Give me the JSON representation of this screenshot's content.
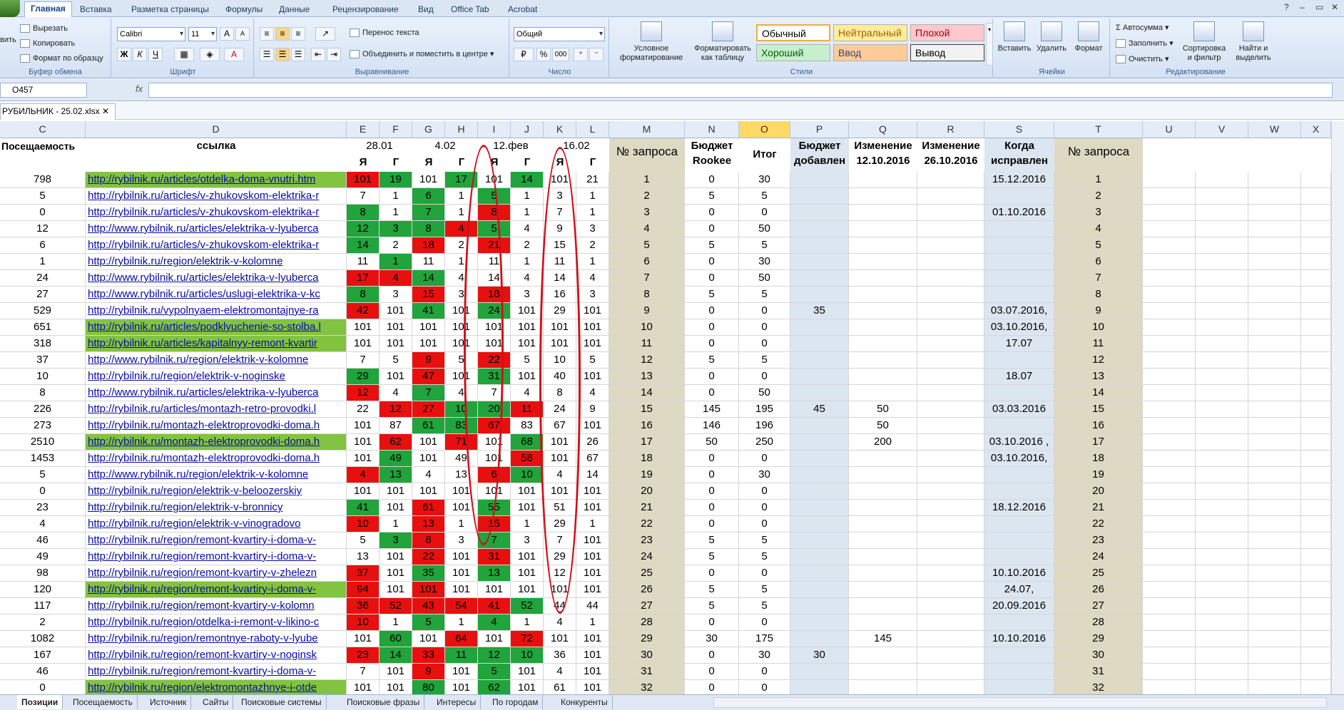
{
  "window": {
    "min": "–",
    "max": "▭",
    "close": "✕",
    "help": "?"
  },
  "ribbon_tabs": [
    "Главная",
    "Вставка",
    "Разметка страницы",
    "Формулы",
    "Данные",
    "Рецензирование",
    "Вид",
    "Office Tab",
    "Acrobat"
  ],
  "clipboard": {
    "cut": "Вырезать",
    "copy": "Копировать",
    "format": "Формат по образцу",
    "paste": "вить",
    "label": "Буфер обмена"
  },
  "font": {
    "name": "Calibri",
    "size": "11",
    "bold": "Ж",
    "italic": "К",
    "underline": "Ч",
    "grow": "A",
    "shrink": "A",
    "label": "Шрифт"
  },
  "align": {
    "wrap": "Перенос текста",
    "merge": "Объединить и поместить в центре",
    "label": "Выравнивание"
  },
  "number": {
    "format": "Общий",
    "pct": "%",
    "thousands": "000",
    "label": "Число"
  },
  "styles": {
    "cond": "Условное форматирование",
    "table": "Форматировать как таблицу",
    "normal": "Обычный",
    "neutral": "Нейтральный",
    "bad": "Плохой",
    "good": "Хороший",
    "input": "Ввод",
    "output": "Вывод",
    "label": "Стили"
  },
  "cells": {
    "insert": "Вставить",
    "delete": "Удалить",
    "format": "Формат",
    "label": "Ячейки"
  },
  "editing": {
    "autosum": "Автосумма",
    "fill": "Заполнить",
    "clear": "Очистить",
    "sort": "Сортировка и фильтр",
    "find": "Найти и выделить",
    "label": "Редактирование"
  },
  "namebox": "O457",
  "fx": "fx",
  "doc_tab": "РУБИЛЬНИК - 25.02.xlsx",
  "columns": [
    "C",
    "D",
    "E",
    "F",
    "G",
    "H",
    "I",
    "J",
    "K",
    "L",
    "M",
    "N",
    "O",
    "P",
    "Q",
    "R",
    "S",
    "T",
    "U",
    "V",
    "W",
    "X"
  ],
  "headers": {
    "c": "Посещаемость",
    "d": "ссылка",
    "d1": "28.01",
    "d2": "4.02",
    "d3": "12.фев",
    "d4": "16.02",
    "ya": "Я",
    "g": "Г",
    "m": "№ запроса",
    "n": "Бюджет Rookee",
    "o": "Итог",
    "p": "Бюджет добавлен",
    "q": "Изменение 12.10.2016",
    "r": "Изменение 26.10.2016",
    "s": "Когда исправлен",
    "t": "№ запроса"
  },
  "rows": [
    {
      "c": "798",
      "d": "http://rybilnik.ru/articles/otdelka-doma-vnutri.htm",
      "dg": 1,
      "v": [
        "101",
        "19",
        "101",
        "17",
        "101",
        "14",
        "101",
        "21"
      ],
      "cl": [
        "r",
        "g",
        "",
        "g",
        "",
        "g",
        "",
        ""
      ],
      "m": "1",
      "n": "0",
      "o": "30",
      "p": "",
      "q": "",
      "s": "15.12.2016",
      "t": "1"
    },
    {
      "c": "5",
      "d": "http://rybilnik.ru/articles/v-zhukovskom-elektrika-r",
      "v": [
        "7",
        "1",
        "6",
        "1",
        "5",
        "1",
        "3",
        "1"
      ],
      "cl": [
        "",
        "",
        "g",
        "",
        "g",
        "",
        "",
        ""
      ],
      "m": "2",
      "n": "5",
      "o": "5",
      "p": "",
      "q": "",
      "s": "",
      "t": "2"
    },
    {
      "c": "0",
      "d": "http://rybilnik.ru/articles/v-zhukovskom-elektrika-r",
      "v": [
        "8",
        "1",
        "7",
        "1",
        "8",
        "1",
        "7",
        "1"
      ],
      "cl": [
        "g",
        "",
        "g",
        "",
        "r",
        "",
        "",
        ""
      ],
      "m": "3",
      "n": "0",
      "o": "0",
      "p": "",
      "q": "",
      "s": "01.10.2016",
      "t": "3"
    },
    {
      "c": "12",
      "d": "http://www.rybilnik.ru/articles/elektrika-v-lyubercа",
      "v": [
        "12",
        "3",
        "8",
        "4",
        "5",
        "4",
        "9",
        "3"
      ],
      "cl": [
        "g",
        "g",
        "g",
        "r",
        "g",
        "",
        "",
        ""
      ],
      "m": "4",
      "n": "0",
      "o": "50",
      "p": "",
      "q": "",
      "s": "",
      "t": "4"
    },
    {
      "c": "6",
      "d": "http://rybilnik.ru/articles/v-zhukovskom-elektrika-r",
      "v": [
        "14",
        "2",
        "18",
        "2",
        "21",
        "2",
        "15",
        "2"
      ],
      "cl": [
        "g",
        "",
        "r",
        "",
        "r",
        "",
        "",
        ""
      ],
      "m": "5",
      "n": "5",
      "o": "5",
      "p": "",
      "q": "",
      "s": "",
      "t": "5"
    },
    {
      "c": "1",
      "d": "http://rybilnik.ru/region/elektrik-v-kolomne",
      "v": [
        "11",
        "1",
        "11",
        "1",
        "11",
        "1",
        "11",
        "1"
      ],
      "cl": [
        "",
        "g",
        "",
        "",
        "",
        "",
        "",
        ""
      ],
      "m": "6",
      "n": "0",
      "o": "30",
      "p": "",
      "q": "",
      "s": "",
      "t": "6"
    },
    {
      "c": "24",
      "d": "http://www.rybilnik.ru/articles/elektrika-v-lyubercа",
      "v": [
        "17",
        "4",
        "14",
        "4",
        "14",
        "4",
        "14",
        "4"
      ],
      "cl": [
        "r",
        "r",
        "g",
        "",
        "",
        "",
        "",
        ""
      ],
      "m": "7",
      "n": "0",
      "o": "50",
      "p": "",
      "q": "",
      "s": "",
      "t": "7"
    },
    {
      "c": "27",
      "d": "http://www.rybilnik.ru/articles/uslugi-elektrika-v-kc",
      "v": [
        "8",
        "3",
        "15",
        "3",
        "18",
        "3",
        "16",
        "3"
      ],
      "cl": [
        "g",
        "",
        "r",
        "",
        "r",
        "",
        "",
        ""
      ],
      "m": "8",
      "n": "5",
      "o": "5",
      "p": "",
      "q": "",
      "s": "",
      "t": "8"
    },
    {
      "c": "529",
      "d": "http://rybilnik.ru/vypolnyaem-elektromontajnye-ra",
      "v": [
        "42",
        "101",
        "41",
        "101",
        "24",
        "101",
        "29",
        "101"
      ],
      "cl": [
        "r",
        "",
        "g",
        "",
        "g",
        "",
        "",
        ""
      ],
      "m": "9",
      "n": "0",
      "o": "0",
      "p": "35",
      "q": "",
      "s": "03.07.2016,",
      "t": "9"
    },
    {
      "c": "651",
      "d": "http://rybilnik.ru/articles/podklyuchenie-so-stolba.l",
      "dg": 1,
      "v": [
        "101",
        "101",
        "101",
        "101",
        "101",
        "101",
        "101",
        "101"
      ],
      "cl": [
        "",
        "",
        "",
        "",
        "",
        "",
        "",
        ""
      ],
      "m": "10",
      "n": "0",
      "o": "0",
      "p": "",
      "q": "",
      "s": "03.10.2016,",
      "t": "10"
    },
    {
      "c": "318",
      "d": "http://rybilnik.ru/articles/kapitalnyy-remont-kvartir",
      "dg": 1,
      "v": [
        "101",
        "101",
        "101",
        "101",
        "101",
        "101",
        "101",
        "101"
      ],
      "cl": [
        "",
        "",
        "",
        "",
        "",
        "",
        "",
        ""
      ],
      "m": "11",
      "n": "0",
      "o": "0",
      "p": "",
      "q": "",
      "s": "17.07",
      "t": "11"
    },
    {
      "c": "37",
      "d": "http://www.rybilnik.ru/region/elektrik-v-kolomne",
      "v": [
        "7",
        "5",
        "9",
        "5",
        "22",
        "5",
        "10",
        "5"
      ],
      "cl": [
        "",
        "",
        "r",
        "",
        "r",
        "",
        "",
        ""
      ],
      "m": "12",
      "n": "5",
      "o": "5",
      "p": "",
      "q": "",
      "s": "",
      "t": "12"
    },
    {
      "c": "10",
      "d": "http://rybilnik.ru/region/elektrik-v-noginske",
      "v": [
        "29",
        "101",
        "47",
        "101",
        "31",
        "101",
        "40",
        "101"
      ],
      "cl": [
        "g",
        "",
        "r",
        "",
        "g",
        "",
        "",
        ""
      ],
      "m": "13",
      "n": "0",
      "o": "0",
      "p": "",
      "q": "",
      "s": "18.07",
      "t": "13"
    },
    {
      "c": "8",
      "d": "http://www.rybilnik.ru/articles/elektrika-v-lyubercа",
      "v": [
        "12",
        "4",
        "7",
        "4",
        "7",
        "4",
        "8",
        "4"
      ],
      "cl": [
        "r",
        "",
        "g",
        "",
        "",
        "",
        "",
        ""
      ],
      "m": "14",
      "n": "0",
      "o": "50",
      "p": "",
      "q": "",
      "s": "",
      "t": "14"
    },
    {
      "c": "226",
      "d": "http://rybilnik.ru/articles/montazh-retro-provodki.l",
      "v": [
        "22",
        "12",
        "27",
        "10",
        "20",
        "11",
        "24",
        "9"
      ],
      "cl": [
        "",
        "r",
        "r",
        "g",
        "g",
        "r",
        "",
        ""
      ],
      "m": "15",
      "n": "145",
      "o": "195",
      "p": "45",
      "q": "50",
      "s": "03.03.2016",
      "t": "15"
    },
    {
      "c": "273",
      "d": "http://rybilnik.ru/montazh-elektroprovodki-doma.h",
      "v": [
        "101",
        "87",
        "61",
        "83",
        "67",
        "83",
        "67",
        "101"
      ],
      "cl": [
        "",
        "",
        "g",
        "g",
        "r",
        "",
        "",
        ""
      ],
      "m": "16",
      "n": "146",
      "o": "196",
      "p": "",
      "q": "50",
      "s": "",
      "t": "16"
    },
    {
      "c": "2510",
      "d": "http://rybilnik.ru/montazh-elektroprovodki-doma.h",
      "dg": 1,
      "v": [
        "101",
        "62",
        "101",
        "71",
        "101",
        "68",
        "101",
        "26"
      ],
      "cl": [
        "",
        "r",
        "",
        "r",
        "",
        "g",
        "",
        ""
      ],
      "m": "17",
      "n": "50",
      "o": "250",
      "p": "",
      "q": "200",
      "s": "03.10.2016 ,",
      "t": "17"
    },
    {
      "c": "1453",
      "d": "http://rybilnik.ru/montazh-elektroprovodki-doma.h",
      "v": [
        "101",
        "49",
        "101",
        "49",
        "101",
        "58",
        "101",
        "67"
      ],
      "cl": [
        "",
        "g",
        "",
        "",
        "",
        "r",
        "",
        ""
      ],
      "m": "18",
      "n": "0",
      "o": "0",
      "p": "",
      "q": "",
      "s": "03.10.2016,",
      "t": "18"
    },
    {
      "c": "5",
      "d": "http://www.rybilnik.ru/region/elektrik-v-kolomne",
      "v": [
        "4",
        "13",
        "4",
        "13",
        "6",
        "10",
        "4",
        "14"
      ],
      "cl": [
        "r",
        "g",
        "",
        "",
        "r",
        "g",
        "",
        ""
      ],
      "m": "19",
      "n": "0",
      "o": "30",
      "p": "",
      "q": "",
      "s": "",
      "t": "19"
    },
    {
      "c": "0",
      "d": "http://rybilnik.ru/region/elektrik-v-beloozerskiy",
      "v": [
        "101",
        "101",
        "101",
        "101",
        "101",
        "101",
        "101",
        "101"
      ],
      "cl": [
        "",
        "",
        "",
        "",
        "",
        "",
        "",
        ""
      ],
      "m": "20",
      "n": "0",
      "o": "0",
      "p": "",
      "q": "",
      "s": "",
      "t": "20"
    },
    {
      "c": "23",
      "d": "http://rybilnik.ru/region/elektrik-v-bronnicy",
      "v": [
        "41",
        "101",
        "61",
        "101",
        "55",
        "101",
        "51",
        "101"
      ],
      "cl": [
        "g",
        "",
        "r",
        "",
        "g",
        "",
        "",
        ""
      ],
      "m": "21",
      "n": "0",
      "o": "0",
      "p": "",
      "q": "",
      "s": "18.12.2016",
      "t": "21"
    },
    {
      "c": "4",
      "d": "http://rybilnik.ru/region/elektrik-v-vinogradovo",
      "v": [
        "10",
        "1",
        "13",
        "1",
        "15",
        "1",
        "29",
        "1"
      ],
      "cl": [
        "r",
        "",
        "r",
        "",
        "r",
        "",
        "",
        ""
      ],
      "m": "22",
      "n": "0",
      "o": "0",
      "p": "",
      "q": "",
      "s": "",
      "t": "22"
    },
    {
      "c": "46",
      "d": "http://rybilnik.ru/region/remont-kvartiry-i-doma-v-",
      "v": [
        "5",
        "3",
        "8",
        "3",
        "7",
        "3",
        "7",
        "101"
      ],
      "cl": [
        "",
        "g",
        "r",
        "",
        "g",
        "",
        "",
        ""
      ],
      "m": "23",
      "n": "5",
      "o": "5",
      "p": "",
      "q": "",
      "s": "",
      "t": "23"
    },
    {
      "c": "49",
      "d": "http://rybilnik.ru/region/remont-kvartiry-i-doma-v-",
      "v": [
        "13",
        "101",
        "22",
        "101",
        "31",
        "101",
        "29",
        "101"
      ],
      "cl": [
        "",
        "",
        "r",
        "",
        "r",
        "",
        "",
        ""
      ],
      "m": "24",
      "n": "5",
      "o": "5",
      "p": "",
      "q": "",
      "s": "",
      "t": "24"
    },
    {
      "c": "98",
      "d": "http://rybilnik.ru/region/remont-kvartiry-v-zhelezn",
      "v": [
        "37",
        "101",
        "35",
        "101",
        "13",
        "101",
        "12",
        "101"
      ],
      "cl": [
        "r",
        "",
        "g",
        "",
        "g",
        "",
        "",
        ""
      ],
      "m": "25",
      "n": "0",
      "o": "0",
      "p": "",
      "q": "",
      "s": "10.10.2016",
      "t": "25"
    },
    {
      "c": "120",
      "d": "http://rybilnik.ru/region/remont-kvartiry-i-doma-v-",
      "dg": 1,
      "v": [
        "94",
        "101",
        "101",
        "101",
        "101",
        "101",
        "101",
        "101"
      ],
      "cl": [
        "r",
        "",
        "r",
        "",
        "",
        "",
        "",
        ""
      ],
      "m": "26",
      "n": "5",
      "o": "5",
      "p": "",
      "q": "",
      "s": "24.07,",
      "t": "26"
    },
    {
      "c": "117",
      "d": "http://rybilnik.ru/region/remont-kvartiry-v-kolomn",
      "v": [
        "36",
        "52",
        "43",
        "54",
        "41",
        "52",
        "44",
        "44"
      ],
      "cl": [
        "r",
        "r",
        "r",
        "r",
        "r",
        "g",
        "",
        ""
      ],
      "m": "27",
      "n": "5",
      "o": "5",
      "p": "",
      "q": "",
      "s": "20.09.2016",
      "t": "27"
    },
    {
      "c": "2",
      "d": "http://rybilnik.ru/region/otdelka-i-remont-v-likino-c",
      "v": [
        "10",
        "1",
        "5",
        "1",
        "4",
        "1",
        "4",
        "1"
      ],
      "cl": [
        "r",
        "",
        "g",
        "",
        "g",
        "",
        "",
        ""
      ],
      "m": "28",
      "n": "0",
      "o": "0",
      "p": "",
      "q": "",
      "s": "",
      "t": "28"
    },
    {
      "c": "1082",
      "d": "http://rybilnik.ru/region/remontnye-raboty-v-lyube",
      "v": [
        "101",
        "60",
        "101",
        "64",
        "101",
        "72",
        "101",
        "101"
      ],
      "cl": [
        "",
        "g",
        "",
        "r",
        "",
        "r",
        "",
        ""
      ],
      "m": "29",
      "n": "30",
      "o": "175",
      "p": "",
      "q": "145",
      "s": "10.10.2016",
      "t": "29"
    },
    {
      "c": "167",
      "d": "http://rybilnik.ru/region/remont-kvartiry-v-noginsk",
      "v": [
        "23",
        "14",
        "33",
        "11",
        "12",
        "10",
        "36",
        "101"
      ],
      "cl": [
        "r",
        "g",
        "r",
        "g",
        "g",
        "g",
        "",
        ""
      ],
      "m": "30",
      "n": "0",
      "o": "30",
      "p": "30",
      "q": "",
      "s": "",
      "t": "30"
    },
    {
      "c": "46",
      "d": "http://rybilnik.ru/region/remont-kvartiry-i-doma-v-",
      "v": [
        "7",
        "101",
        "9",
        "101",
        "5",
        "101",
        "4",
        "101"
      ],
      "cl": [
        "",
        "",
        "r",
        "",
        "g",
        "",
        "",
        ""
      ],
      "m": "31",
      "n": "0",
      "o": "0",
      "p": "",
      "q": "",
      "s": "",
      "t": "31"
    },
    {
      "c": "0",
      "d": "http://rybilnik.ru/region/elektromontazhnye-i-otde",
      "dg": 1,
      "v": [
        "101",
        "101",
        "80",
        "101",
        "62",
        "101",
        "61",
        "101"
      ],
      "cl": [
        "",
        "",
        "g",
        "",
        "g",
        "",
        "",
        ""
      ],
      "m": "32",
      "n": "0",
      "o": "0",
      "p": "",
      "q": "",
      "s": "",
      "t": "32"
    }
  ],
  "sheet_tabs": [
    "Позиции",
    "Посещаемость",
    "Источник",
    "Сайты",
    "Поисковые системы",
    "Поисковые фразы",
    "Интересы",
    "По городам",
    "Конкуренты"
  ],
  "colors": {
    "red": "#e8100f",
    "green": "#21a43b",
    "linkgreen": "#82c341",
    "tan": "#ddd9c3",
    "blue": "#dce6f1",
    "oheader": "#ffd966"
  }
}
